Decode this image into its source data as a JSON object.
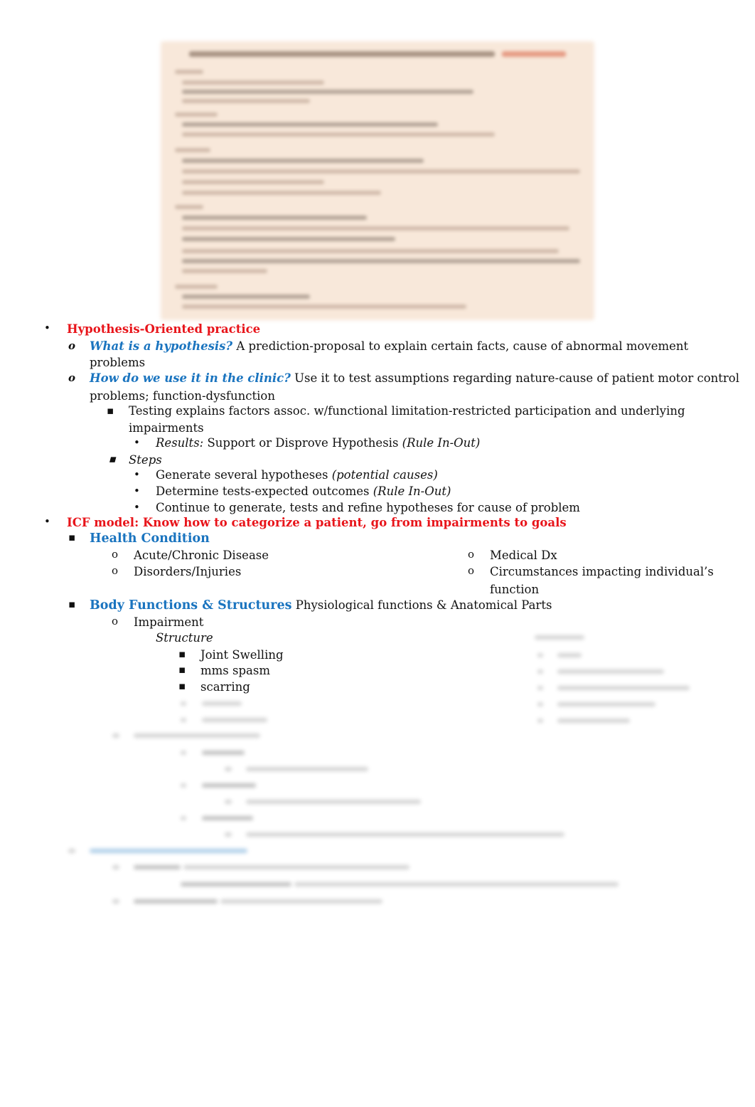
{
  "embedded_image": {
    "description": "blurred table image",
    "blurred": true
  },
  "sections": {
    "hypothesis": {
      "heading": "Hypothesis-Oriented practice",
      "q1_label": "What is a hypothesis?",
      "q1_text": " A prediction-proposal to explain certain facts, cause of abnormal movement",
      "q1_text_cont": "problems",
      "q2_label": "How do we use it in the clinic?",
      "q2_text": " Use it to test assumptions regarding nature-cause of patient motor control",
      "q2_text_cont": "problems; function-dysfunction",
      "testing_text": "Testing explains factors assoc. w/functional limitation-restricted participation and underlying",
      "testing_text_cont": "impairments",
      "results_label": "Results:",
      "results_text": " Support or Disprove Hypothesis ",
      "results_paren": "(Rule In-Out)",
      "steps_label": "Steps",
      "steps": [
        {
          "text": "Generate several hypotheses ",
          "italic": "(potential causes)"
        },
        {
          "text": "Determine tests-expected outcomes ",
          "italic": "(Rule In-Out)"
        },
        {
          "text": "Continue to generate, tests and refine hypotheses for cause of problem",
          "italic": ""
        }
      ]
    },
    "icf": {
      "heading": "ICF model: Know how to categorize a patient, go from impairments to goals",
      "health_condition": {
        "label": "Health Condition",
        "left_items": [
          "Acute/Chronic Disease",
          "Disorders/Injuries"
        ],
        "right_items": [
          "Medical Dx",
          "Circumstances impacting individual’s"
        ],
        "right_item_cont": "function"
      },
      "body_functions": {
        "label": "Body Functions & Structures",
        "text": " Physiological functions & Anatomical Parts",
        "impairment_label": "Impairment",
        "structure_label": "Structure",
        "structure_items": [
          "Joint Swelling",
          "mms spasm",
          "scarring"
        ]
      }
    }
  },
  "bullets": {
    "disc": "•",
    "circle_italic": "o",
    "circle": "o",
    "square": "▪"
  }
}
